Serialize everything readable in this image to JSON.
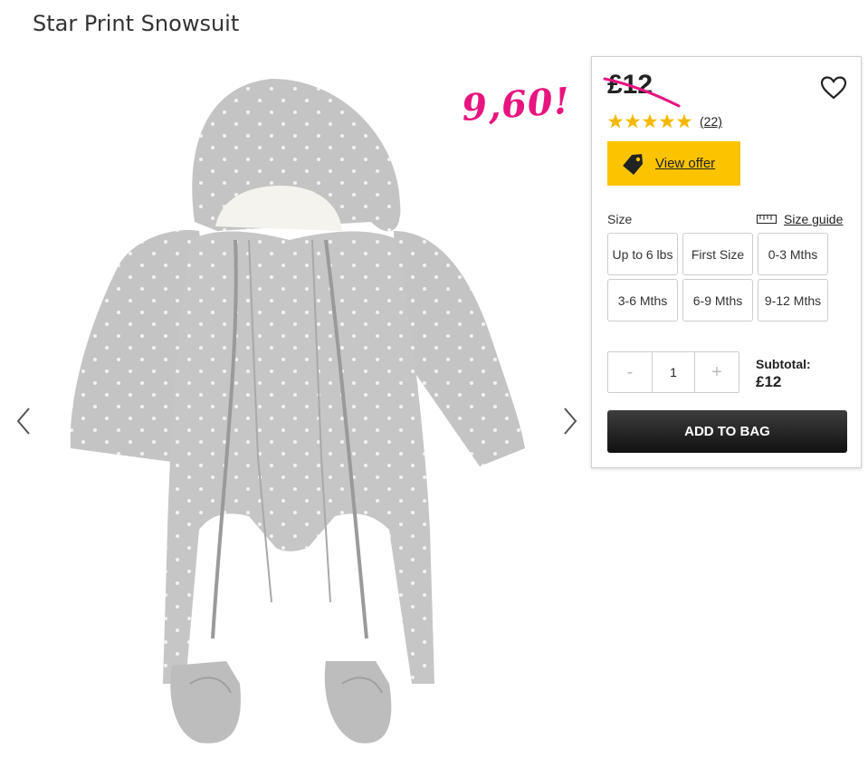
{
  "product": {
    "title": "Star Print Snowsuit"
  },
  "annotation": {
    "text": "9,60!",
    "color": "#e8147f"
  },
  "gallery": {
    "prev_icon": "chevron-left-icon",
    "next_icon": "chevron-right-icon"
  },
  "purchase_panel": {
    "price": "£12",
    "price_struck_through": true,
    "wishlist_icon": "heart-outline-icon",
    "rating": {
      "stars": 5,
      "out_of": 5,
      "reviews_text": "(22)",
      "star_color": "#f5b800"
    },
    "offer": {
      "icon": "price-tag-icon",
      "label": "View offer",
      "background": "#fcc300"
    },
    "size": {
      "label": "Size",
      "guide_icon": "ruler-icon",
      "guide_label": "Size guide",
      "options": [
        "Up to 6 lbs",
        "First Size",
        "0-3 Mths",
        "3-6 Mths",
        "6-9 Mths",
        "9-12 Mths"
      ]
    },
    "quantity": {
      "minus": "-",
      "value": "1",
      "plus": "+"
    },
    "subtotal": {
      "label": "Subtotal:",
      "value": "£12"
    },
    "add_to_bag": "ADD TO BAG"
  }
}
